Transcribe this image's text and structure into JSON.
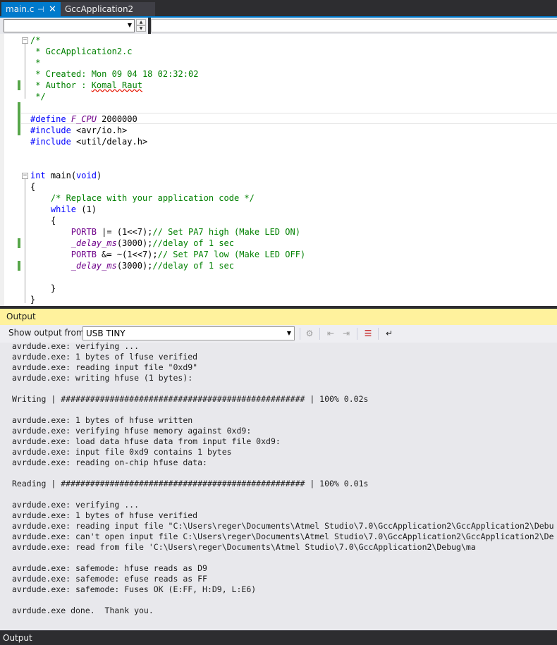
{
  "tabs": [
    {
      "label": "main.c",
      "active": true
    },
    {
      "label": "GccApplication2",
      "active": false
    }
  ],
  "tab_icons": {
    "pin": "⊣",
    "close": "✕"
  },
  "code": {
    "header_comment": [
      "/*",
      " * GccApplication2.c",
      " *",
      " * Created: Mon 09 04 18 02:32:02",
      " * Author : ",
      " */"
    ],
    "author_name": "Komal Raut",
    "define_kw": "#define",
    "define_name": "F_CPU",
    "define_value": " 2000000",
    "include1_kw": "#include",
    "include1_path": " <avr/io.h>",
    "include2_kw": "#include",
    "include2_path": " <util/delay.h>",
    "main_kw": "int",
    "main_name": " main",
    "main_paren_open": "(",
    "main_void": "void",
    "main_paren_close": ")",
    "open_brace": "{",
    "replace_comment": "    /* Replace with your application code */",
    "while_kw": "    while",
    "while_cond": " (1)",
    "while_open": "    {",
    "l1_macro": "        PORTB",
    "l1_code": " |= (1<<7);",
    "l1_comment": "// Set PA7 high (Make LED ON)",
    "l2_func": "        _delay_ms",
    "l2_code": "(3000);",
    "l2_comment": "//delay of 1 sec",
    "l3_macro": "        PORTB",
    "l3_code": " &= ~(1<<7);",
    "l3_comment": "// Set PA7 low (Make LED OFF)",
    "l4_func": "        _delay_ms",
    "l4_code": "(3000);",
    "l4_comment": "//delay of 1 sec",
    "while_close": "    }",
    "close_brace": "}"
  },
  "output": {
    "title": "Output",
    "show_from_label": "Show output from:",
    "source": "USB TINY",
    "lines": [
      "avrdude.exe: verifying ...",
      "avrdude.exe: 1 bytes of lfuse verified",
      "avrdude.exe: reading input file \"0xd9\"",
      "avrdude.exe: writing hfuse (1 bytes):",
      "",
      "Writing | ################################################## | 100% 0.02s",
      "",
      "avrdude.exe: 1 bytes of hfuse written",
      "avrdude.exe: verifying hfuse memory against 0xd9:",
      "avrdude.exe: load data hfuse data from input file 0xd9:",
      "avrdude.exe: input file 0xd9 contains 1 bytes",
      "avrdude.exe: reading on-chip hfuse data:",
      "",
      "Reading | ################################################## | 100% 0.01s",
      "",
      "avrdude.exe: verifying ...",
      "avrdude.exe: 1 bytes of hfuse verified",
      "avrdude.exe: reading input file \"C:\\Users\\reger\\Documents\\Atmel Studio\\7.0\\GccApplication2\\GccApplication2\\Debu",
      "avrdude.exe: can't open input file C:\\Users\\reger\\Documents\\Atmel Studio\\7.0\\GccApplication2\\GccApplication2\\De",
      "avrdude.exe: read from file 'C:\\Users\\reger\\Documents\\Atmel Studio\\7.0\\GccApplication2\\Debug\\ma",
      "",
      "avrdude.exe: safemode: hfuse reads as D9",
      "avrdude.exe: safemode: efuse reads as FF",
      "avrdude.exe: safemode: Fuses OK (E:FF, H:D9, L:E6)",
      "",
      "avrdude.exe done.  Thank you."
    ]
  },
  "toolbar_icons": {
    "find_message": "⚙",
    "prev_message": "⇤",
    "next_message": "⇥",
    "clear_all": "☰",
    "word_wrap": "↵"
  },
  "status": {
    "tab_label": "Output"
  }
}
